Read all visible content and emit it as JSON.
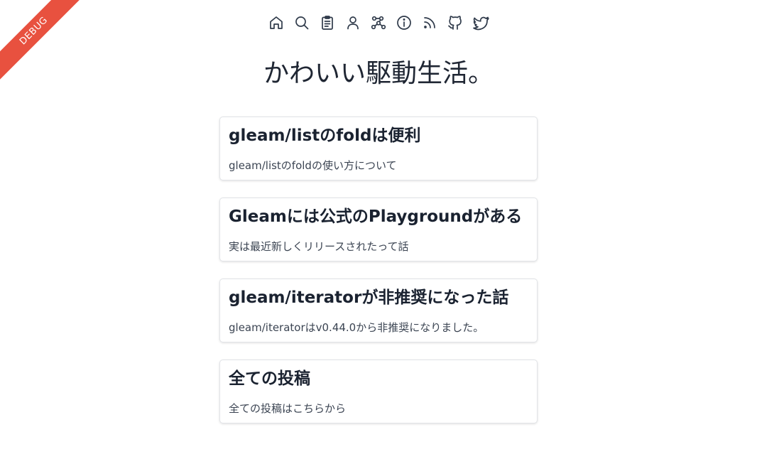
{
  "debug_banner": {
    "label": "DEBUG"
  },
  "nav": {
    "icons": [
      {
        "name": "home-icon"
      },
      {
        "name": "search-icon"
      },
      {
        "name": "clipboard-icon"
      },
      {
        "name": "user-icon"
      },
      {
        "name": "graph-icon"
      },
      {
        "name": "info-icon"
      },
      {
        "name": "rss-icon"
      },
      {
        "name": "github-icon"
      },
      {
        "name": "twitter-icon"
      }
    ]
  },
  "site": {
    "title": "かわいい駆動生活。"
  },
  "posts": [
    {
      "title": "gleam/listのfoldは便利",
      "description": "gleam/listのfoldの使い方について"
    },
    {
      "title": "Gleamには公式のPlaygroundがある",
      "description": "実は最近新しくリリースされたって話"
    },
    {
      "title": "gleam/iteratorが非推奨になった話",
      "description": "gleam/iteratorはv0.44.0から非推奨になりました。"
    },
    {
      "title": "全ての投稿",
      "description": "全ての投稿はこちらから"
    }
  ],
  "colors": {
    "text": "#1f2633",
    "ribbon": "#e8513f",
    "card_border": "#e2e4e8"
  }
}
